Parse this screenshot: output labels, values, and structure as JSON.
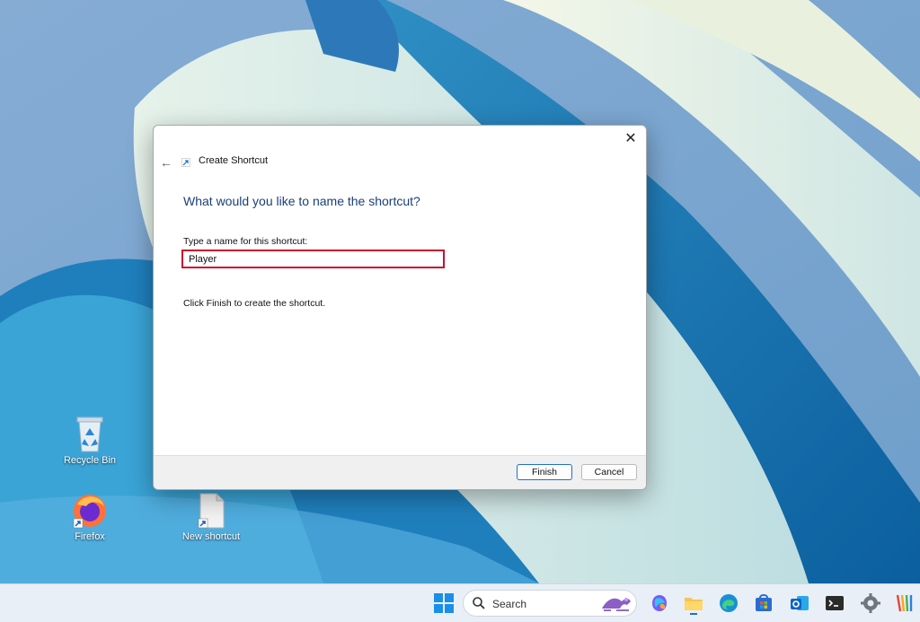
{
  "desktop": {
    "icons": [
      {
        "label": "Recycle Bin",
        "icon": "recycle-bin-icon"
      },
      {
        "label": "Firefox",
        "icon": "firefox-icon"
      },
      {
        "label": "New shortcut",
        "icon": "shortcut-file-icon"
      }
    ]
  },
  "dialog": {
    "close_label": "✕",
    "back_label": "←",
    "title": "Create Shortcut",
    "heading": "What would you like to name the shortcut?",
    "name_label": "Type a name for this shortcut:",
    "name_value": "Player",
    "finish_text": "Click Finish to create the shortcut.",
    "finish_button": "Finish",
    "cancel_button": "Cancel",
    "highlight_color": "#c8102e"
  },
  "taskbar": {
    "search_placeholder": "Search",
    "apps": [
      "start-icon",
      "copilot-icon",
      "file-explorer-icon",
      "edge-icon",
      "store-icon",
      "outlook-icon",
      "terminal-icon",
      "settings-icon",
      "paint-icon"
    ]
  }
}
